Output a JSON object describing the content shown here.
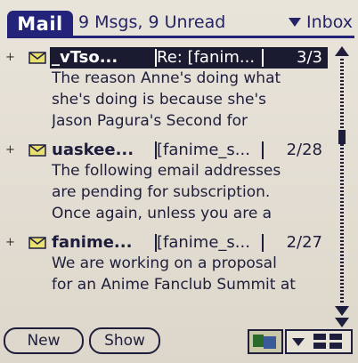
{
  "header": {
    "app_label": "Mail",
    "message_count": "9 Msgs, 9 Unread",
    "folder": "Inbox"
  },
  "messages": [
    {
      "sender": "_vTso...",
      "subject": "Re: [fanim...",
      "date": "3/3",
      "preview": [
        "The reason Anne's doing what",
        "she's doing is because she's",
        "Jason Pagura's Second for"
      ],
      "selected": true
    },
    {
      "sender": "uaskee...",
      "subject": "[fanime_s...",
      "date": "2/28",
      "preview": [
        "The following email addresses",
        "are pending for subscription.",
        "Once again, unless you are a"
      ],
      "selected": false
    },
    {
      "sender": "fanime...",
      "subject": "[fanime_s...",
      "date": "2/27",
      "preview": [
        "We are working on a proposal",
        "for an Anime Fanclub Summit at"
      ],
      "selected": false
    }
  ],
  "buttons": {
    "new_label": "New",
    "show_label": "Show"
  },
  "icons": {
    "envelope": "envelope-icon",
    "scroll_up": "scroll-up-icon",
    "scroll_down": "scroll-down-icon",
    "dropdown": "dropdown-triangle-icon",
    "toolbar_books": "books-icon",
    "toolbar_grid": "grid-icon"
  },
  "colors": {
    "header_bg": "#23237a",
    "text": "#1e1e3c",
    "screen_bg": "#e4dfd4",
    "selection": "#1a1a30"
  }
}
